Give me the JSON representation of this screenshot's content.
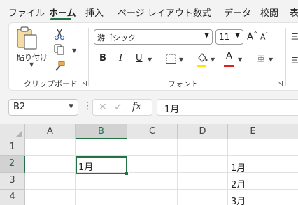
{
  "tabs": [
    "ファイル",
    "ホーム",
    "挿入",
    "ページ レイアウト",
    "数式",
    "データ",
    "校閲",
    "表"
  ],
  "ribbon": {
    "paste_label": "貼り付け",
    "clipboard_label": "クリップボード",
    "font_label": "フォント",
    "font_name": "游ゴシック",
    "font_size": "11",
    "bold": "B",
    "italic": "I",
    "underline": "U",
    "highlight_color": "#ffe600",
    "font_color": "#e02020"
  },
  "formula_bar": {
    "name_box": "B2",
    "fx": "fx",
    "formula": "1月"
  },
  "grid": {
    "columns": [
      "A",
      "B",
      "C",
      "D",
      "E"
    ],
    "rows": [
      "1",
      "2",
      "3",
      "4"
    ],
    "selected_column": "B",
    "selected_row": "2",
    "cells": {
      "B2": "1月",
      "E2": "1月",
      "E3": "2月",
      "E4": "3月"
    }
  },
  "accent_color": "#217346"
}
